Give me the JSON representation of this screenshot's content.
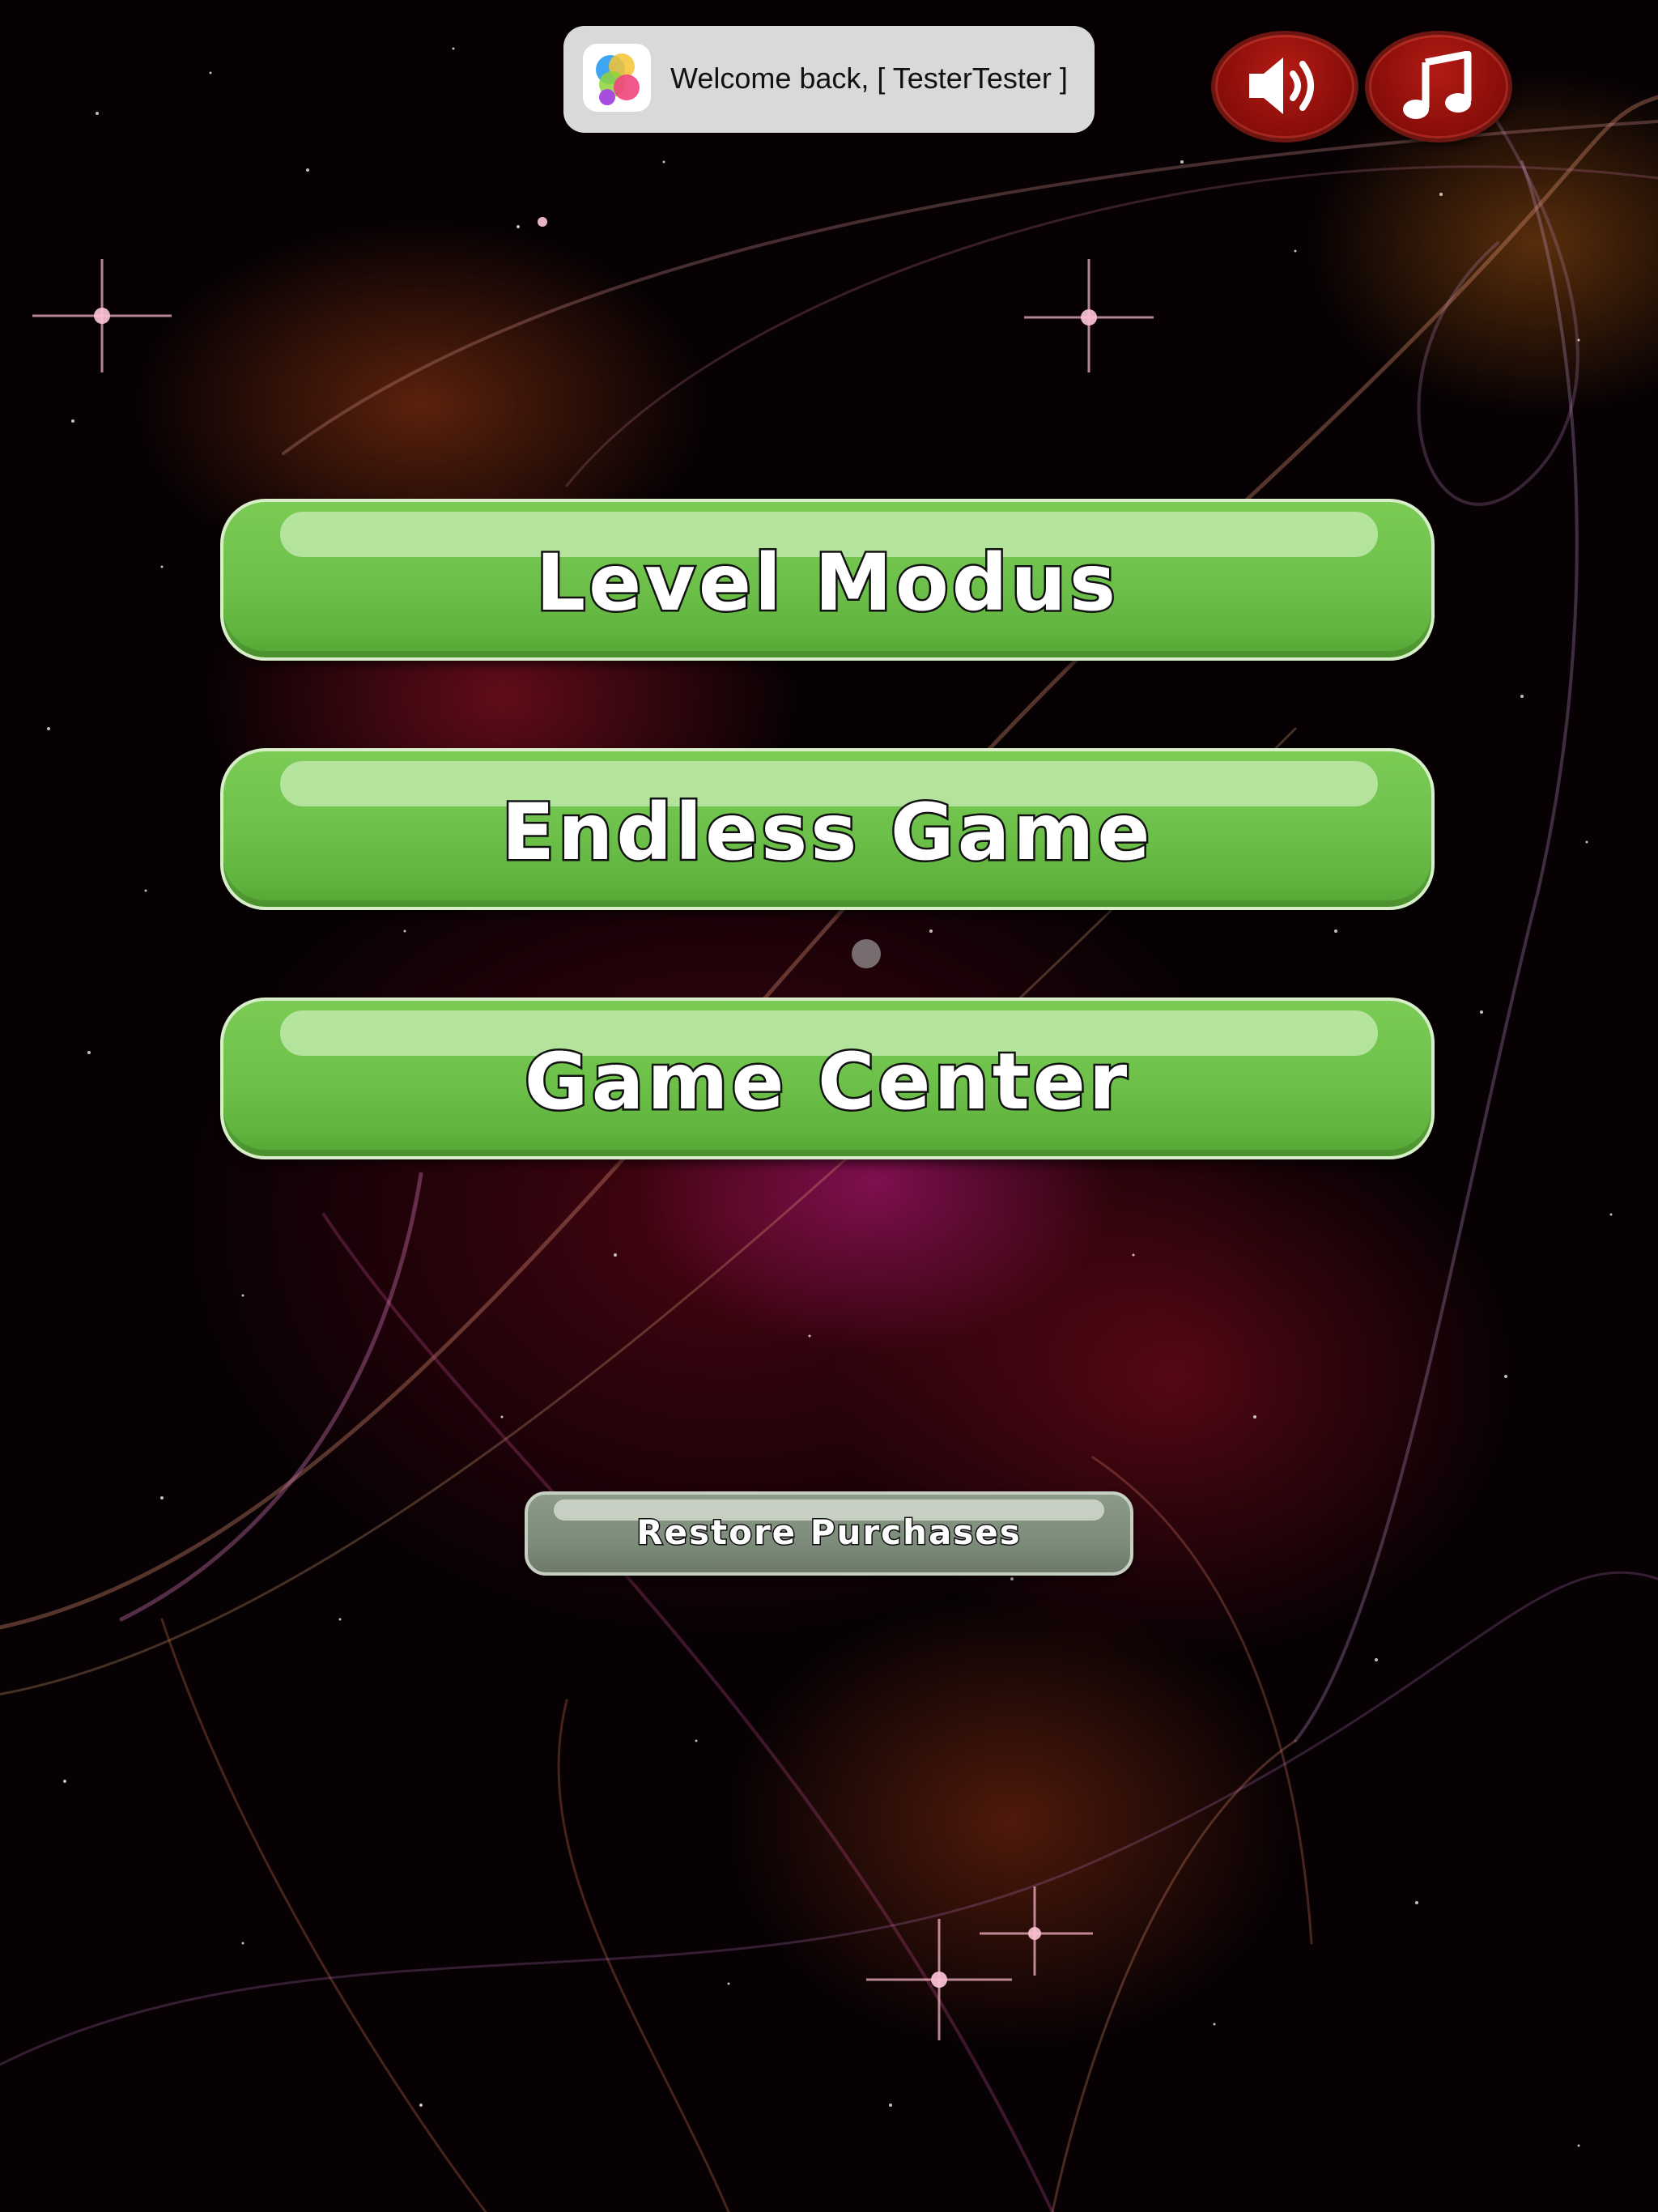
{
  "notification": {
    "message": "Welcome back, [ TesterTester ]",
    "icon": "game-center-icon"
  },
  "audio_controls": {
    "sound_icon": "speaker-icon",
    "music_icon": "music-note-icon"
  },
  "menu": {
    "level_mode": "Level Modus",
    "endless_game": "Endless Game",
    "game_center": "Game Center",
    "restore_purchases": "Restore Purchases"
  },
  "colors": {
    "green_button": "#6cc049",
    "round_button": "#8a0e0a",
    "restore_button": "#7e8c7b",
    "banner": "#d9d9d9"
  }
}
